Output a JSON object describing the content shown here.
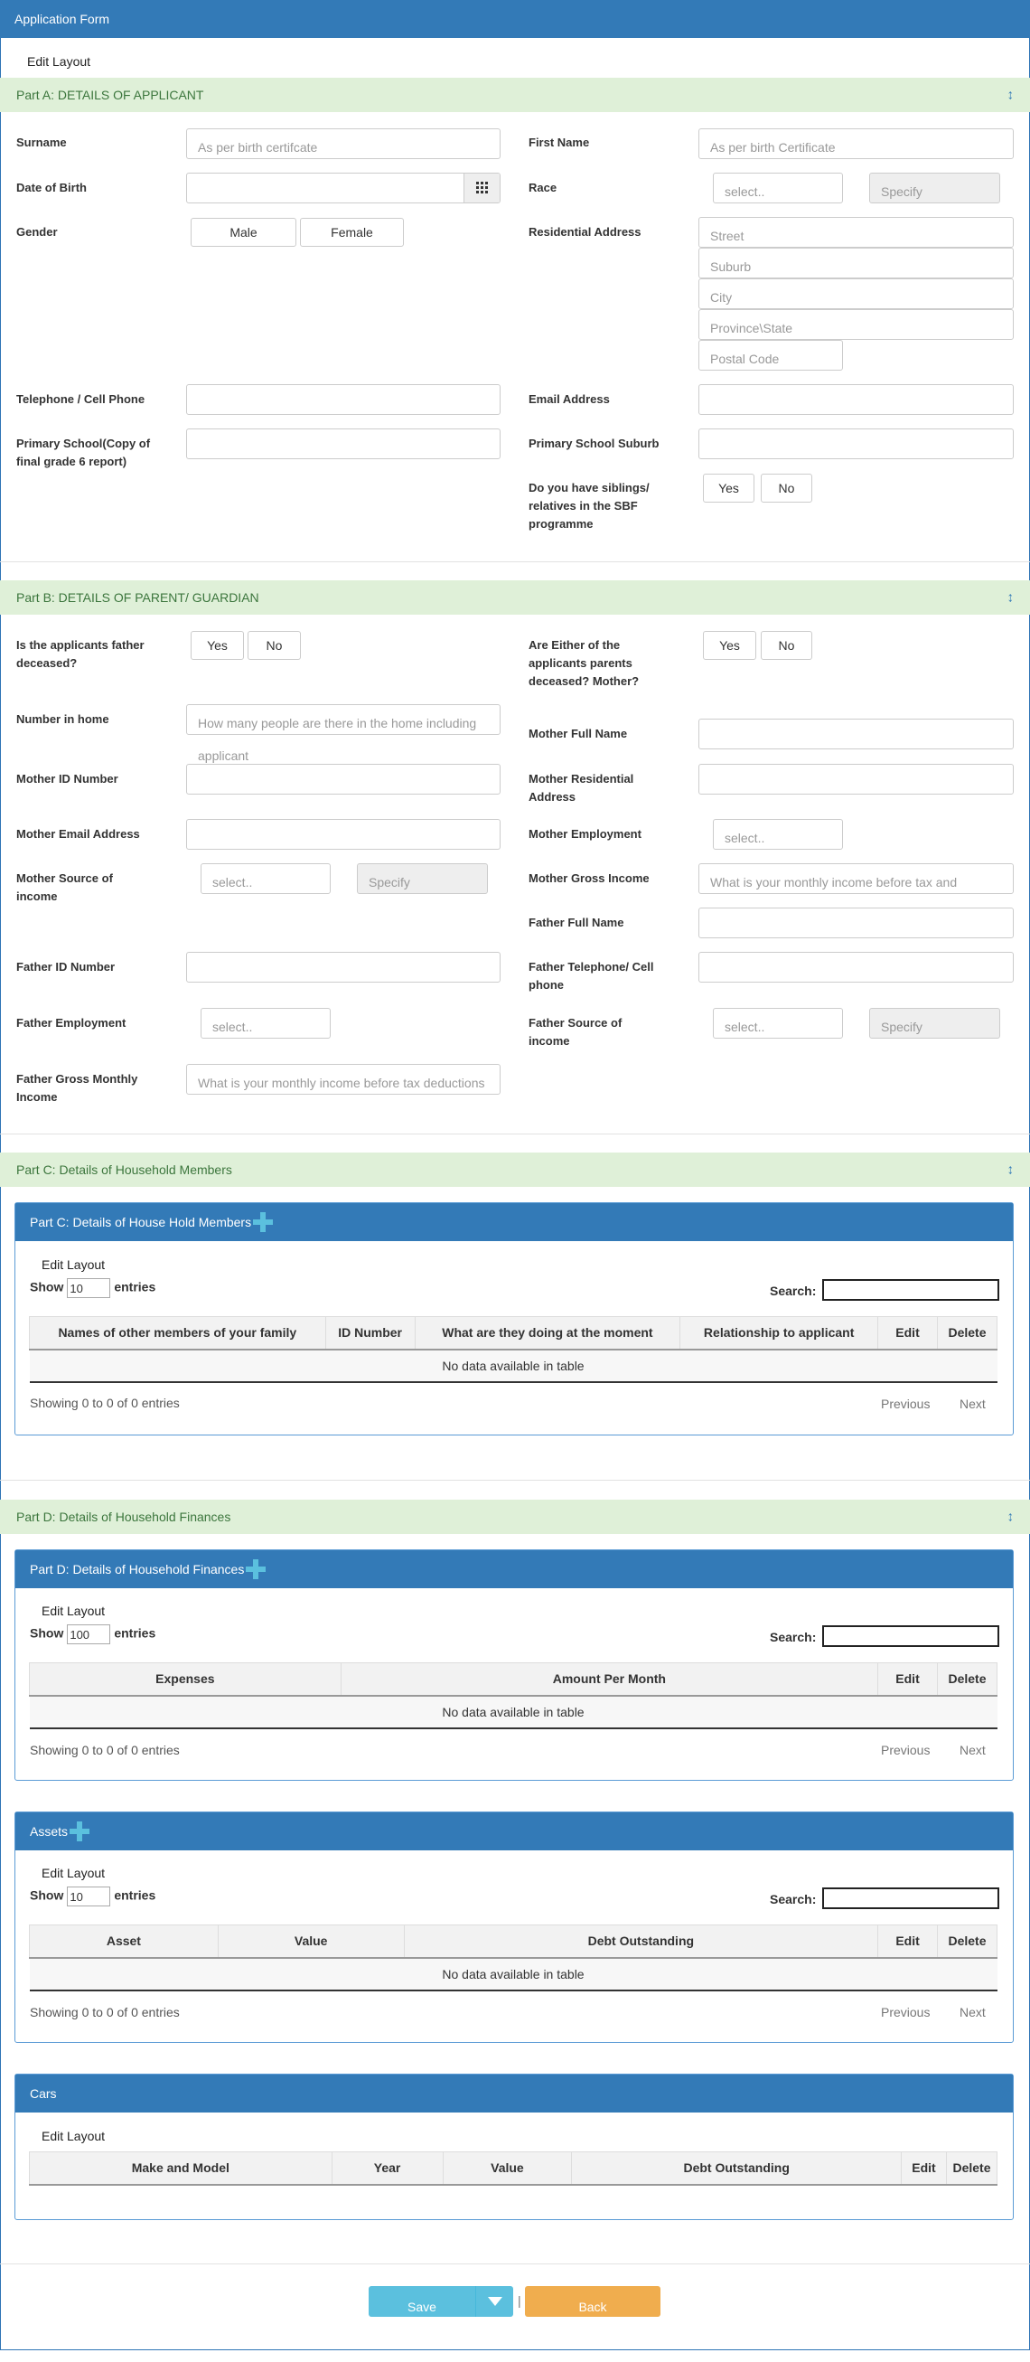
{
  "title": "Application Form",
  "edit_layout": "Edit Layout",
  "colors": {
    "primary": "#337ab7",
    "section_bg": "#dff0d8",
    "section_text": "#3c763d",
    "save": "#5bc0de",
    "back": "#f0ad4e"
  },
  "partA": {
    "title": "Part A: DETAILS OF APPLICANT",
    "toggle_icon": "expand-collapse-icon",
    "surname_label": "Surname",
    "surname_ph": "As per birth certifcate",
    "firstname_label": "First Name",
    "firstname_ph": "As per birth Certificate",
    "dob_label": "Date of Birth",
    "calendar_icon": "calendar-icon",
    "race_label": "Race",
    "race_select": "select..",
    "race_specify": "Specify",
    "gender_label": "Gender",
    "male": "Male",
    "female": "Female",
    "address_label": "Residential Address",
    "street": "Street",
    "suburb": "Suburb",
    "city": "City",
    "province": "Province\\State",
    "postal": "Postal Code",
    "phone_label": "Telephone / Cell Phone",
    "email_label": "Email Address",
    "school_label": "Primary School(Copy of final grade 6 report)",
    "school_suburb_label": "Primary School Suburb",
    "siblings_label": "Do you have siblings/ relatives in the SBF programme",
    "yes": "Yes",
    "no": "No"
  },
  "partB": {
    "title": "Part B: DETAILS OF PARENT/ GUARDIAN",
    "father_deceased_label": "Is the applicants father deceased?",
    "either_deceased_label": "Are Either of the applicants parents deceased? Mother?",
    "yes": "Yes",
    "no": "No",
    "number_home_label": "Number in home",
    "number_home_ph_1": "How many people are there in the home including",
    "number_home_ph_2": "applicant",
    "mother_name_label": "Mother Full Name",
    "mother_id_label": "Mother ID Number",
    "mother_res_label": "Mother Residential Address",
    "mother_email_label": "Mother Email Address",
    "mother_emp_label": "Mother Employment",
    "mother_emp_select": "select..",
    "mother_source_label": "Mother Source of income",
    "mother_source_select": "select..",
    "mother_source_specify": "Specify",
    "mother_gross_label": "Mother Gross Income",
    "mother_gross_ph": "What is your monthly income before tax and",
    "father_name_label": "Father Full Name",
    "father_id_label": "Father ID Number",
    "father_phone_label": "Father Telephone/ Cell phone",
    "father_emp_label": "Father Employment",
    "father_emp_select": "select..",
    "father_source_label": "Father Source of income",
    "father_source_select": "select..",
    "father_source_specify": "Specify",
    "father_gross_label": "Father Gross Monthly Income",
    "father_gross_ph": "What is your monthly income before tax deductions"
  },
  "partC": {
    "title": "Part C: Details of Household Members",
    "table_title": "Part C: Details of House Hold Members",
    "add_icon": "plus-icon",
    "length": "10",
    "columns": [
      "Names of other members of your family",
      "ID Number",
      "What are they doing at the moment",
      "Relationship to applicant",
      "Edit",
      "Delete"
    ]
  },
  "partD": {
    "title": "Part D: Details of Household Finances",
    "table_title": "Part D: Details of Household Finances",
    "add_icon": "plus-icon",
    "length": "100",
    "columns": [
      "Expenses",
      "Amount Per Month",
      "Edit",
      "Delete"
    ]
  },
  "assets": {
    "title": "Assets",
    "add_icon": "plus-icon",
    "length": "10",
    "columns": [
      "Asset",
      "Value",
      "Debt Outstanding",
      "Edit",
      "Delete"
    ]
  },
  "cars": {
    "title": "Cars",
    "columns": [
      "Make and Model",
      "Year",
      "Value",
      "Debt Outstanding",
      "Edit",
      "Delete"
    ]
  },
  "dt": {
    "show": "Show",
    "entries": "entries",
    "search": "Search:",
    "empty": "No data available in table",
    "info": "Showing 0 to 0 of 0 entries",
    "previous": "Previous",
    "next": "Next"
  },
  "footer": {
    "save": "Save",
    "sep": "|",
    "back": "Back",
    "dropdown_icon": "caret-down-icon"
  }
}
